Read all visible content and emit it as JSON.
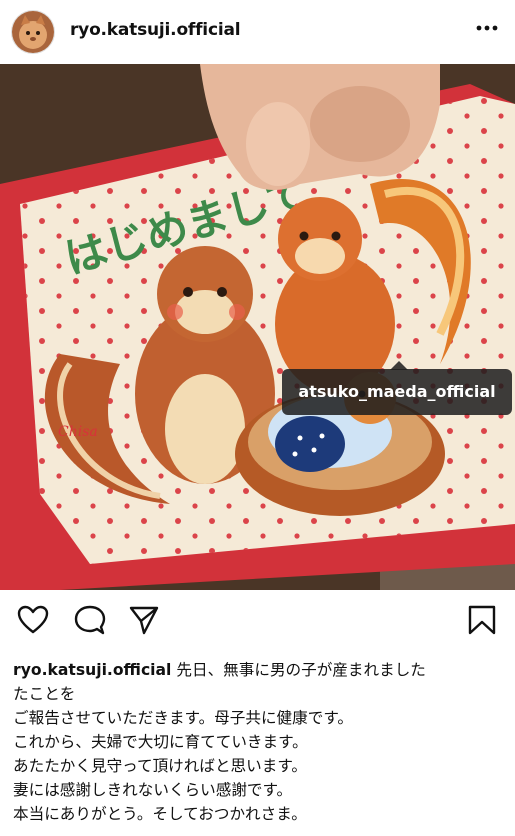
{
  "header": {
    "username": "ryo.katsuji.official",
    "avatar_icon": "cat-avatar-icon",
    "more_icon": "more-options-icon"
  },
  "photo": {
    "card_text": "はじめまして",
    "signature": "Chisa",
    "tag_label": "atsuko_maeda_official"
  },
  "actions": {
    "like_icon": "heart-icon",
    "comment_icon": "comment-icon",
    "share_icon": "share-icon",
    "save_icon": "bookmark-icon"
  },
  "caption": {
    "username": "ryo.katsuji.official",
    "first_line_text": "先日、無事に男の子が産まれました",
    "lines": [
      "たことを",
      "ご報告させていただきます。母子共に健康です。",
      "これから、夫婦で大切に育てていきます。",
      "あたたかく見守って頂ければと思います。",
      "妻には感謝しきれないくらい感謝です。",
      "本当にありがとう。そしておつかれさま。"
    ]
  },
  "colors": {
    "accent_red": "#d8323a",
    "card_cream": "#f5ead7",
    "squirrel": "#c8642a",
    "text": "#111111"
  }
}
